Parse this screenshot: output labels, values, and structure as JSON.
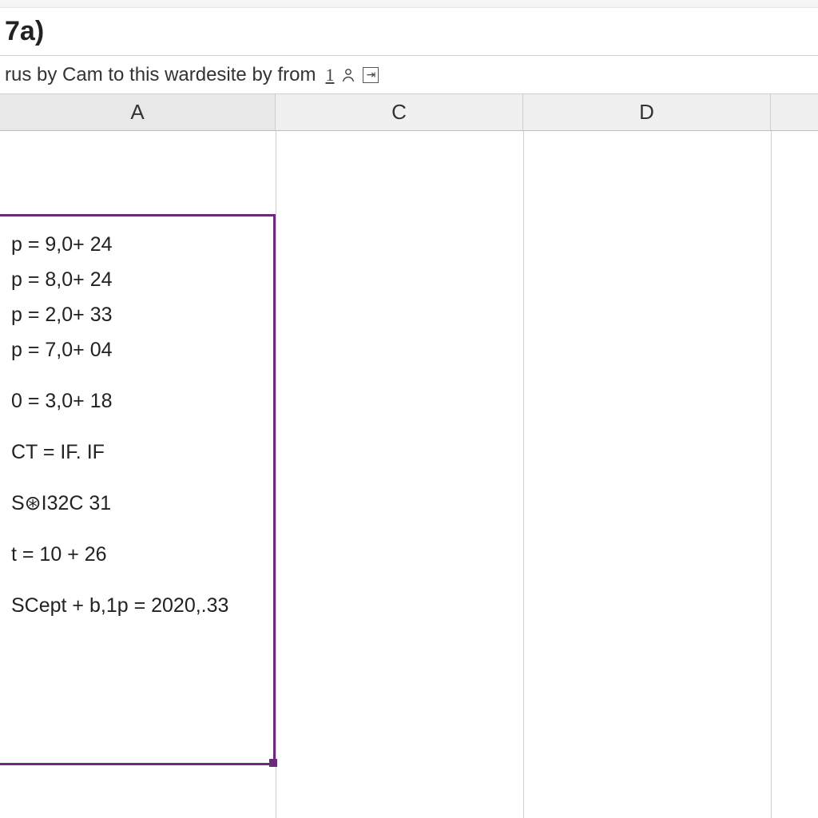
{
  "title": "7a)",
  "subtext": "rus by Cam to this wardesite by from",
  "icons": {
    "underline": "1",
    "person": "person-icon",
    "boxglyph": "⇥"
  },
  "columns": {
    "A": "A",
    "C": "C",
    "D": "D",
    "E": ""
  },
  "cell_lines": [
    "p = 9,0+ 24",
    "p = 8,0+ 24",
    "p = 2,0+ 33",
    "p = 7,0+ 04",
    "",
    "0 = 3,0+ 18",
    "",
    "CT = IF. IF",
    "",
    "S⊛I32C 31",
    "",
    "t = 10 + 26",
    "",
    "SCept + b,1p = 2020,.33"
  ],
  "chart_data": {
    "type": "table",
    "note": "text content of selected spreadsheet cell",
    "lines": [
      "p = 9,0+ 24",
      "p = 8,0+ 24",
      "p = 2,0+ 33",
      "p = 7,0+ 04",
      "0 = 3,0+ 18",
      "CT = IF. IF",
      "S⊛I32C 31",
      "t = 10 + 26",
      "SCept + b,1p = 2020,.33"
    ]
  }
}
